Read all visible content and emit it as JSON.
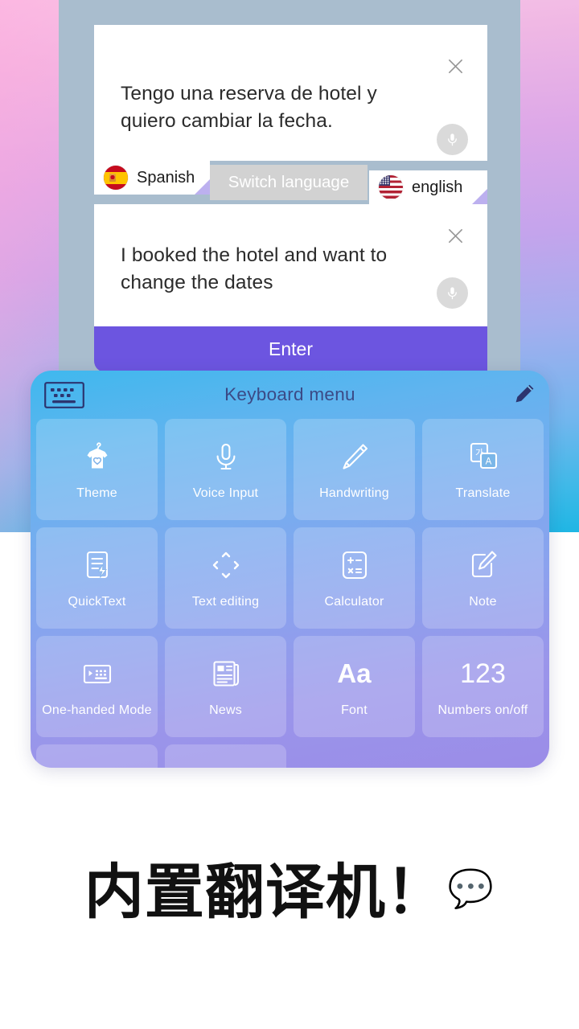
{
  "background": {
    "gradient_from": "#f8c8e8",
    "gradient_mid": "#a3aeee",
    "gradient_to": "#1fb6e4",
    "panel_color": "#a9bdce"
  },
  "translator": {
    "source_card": {
      "text": "Tengo una reserva de hotel y quiero cambiar la fecha.",
      "close_icon": "close-icon",
      "mic_icon": "microphone-icon"
    },
    "target_card": {
      "text": "I booked the hotel and want to change the dates",
      "close_icon": "close-icon",
      "mic_icon": "microphone-icon"
    },
    "language_bar": {
      "source_language": "Spanish",
      "source_flag": "spain-flag-icon",
      "target_language": "english",
      "target_flag": "usa-flag-icon",
      "switch_label": "Switch language",
      "switch_bg": "#d2d2d2"
    },
    "enter_label": "Enter",
    "enter_color": "#6c55e0"
  },
  "keyboard_menu": {
    "title": "Keyboard menu",
    "keyboard_icon": "keyboard-icon",
    "edit_icon": "pencil-icon",
    "title_color": "#3b4a86",
    "tiles": [
      {
        "label": "Theme",
        "icon": "tshirt-hanger-icon"
      },
      {
        "label": "Voice Input",
        "icon": "microphone-icon"
      },
      {
        "label": "Handwriting",
        "icon": "pencil-icon"
      },
      {
        "label": "Translate",
        "icon": "translate-cards-icon"
      },
      {
        "label": "QuickText",
        "icon": "document-lightning-icon"
      },
      {
        "label": "Text editing",
        "icon": "four-way-arrows-icon"
      },
      {
        "label": "Calculator",
        "icon": "calculator-icon"
      },
      {
        "label": "Note",
        "icon": "note-pencil-icon"
      },
      {
        "label": "One-handed Mode",
        "icon": "one-handed-keyboard-icon"
      },
      {
        "label": "News",
        "icon": "newspaper-icon"
      },
      {
        "label": "Font",
        "icon": "font-aa-glyph",
        "glyph": "Aa"
      },
      {
        "label": "Numbers on/off",
        "icon": "numbers-123-glyph",
        "glyph": "123"
      }
    ]
  },
  "caption": {
    "text": "内置翻译机！",
    "emoji": "💬"
  }
}
